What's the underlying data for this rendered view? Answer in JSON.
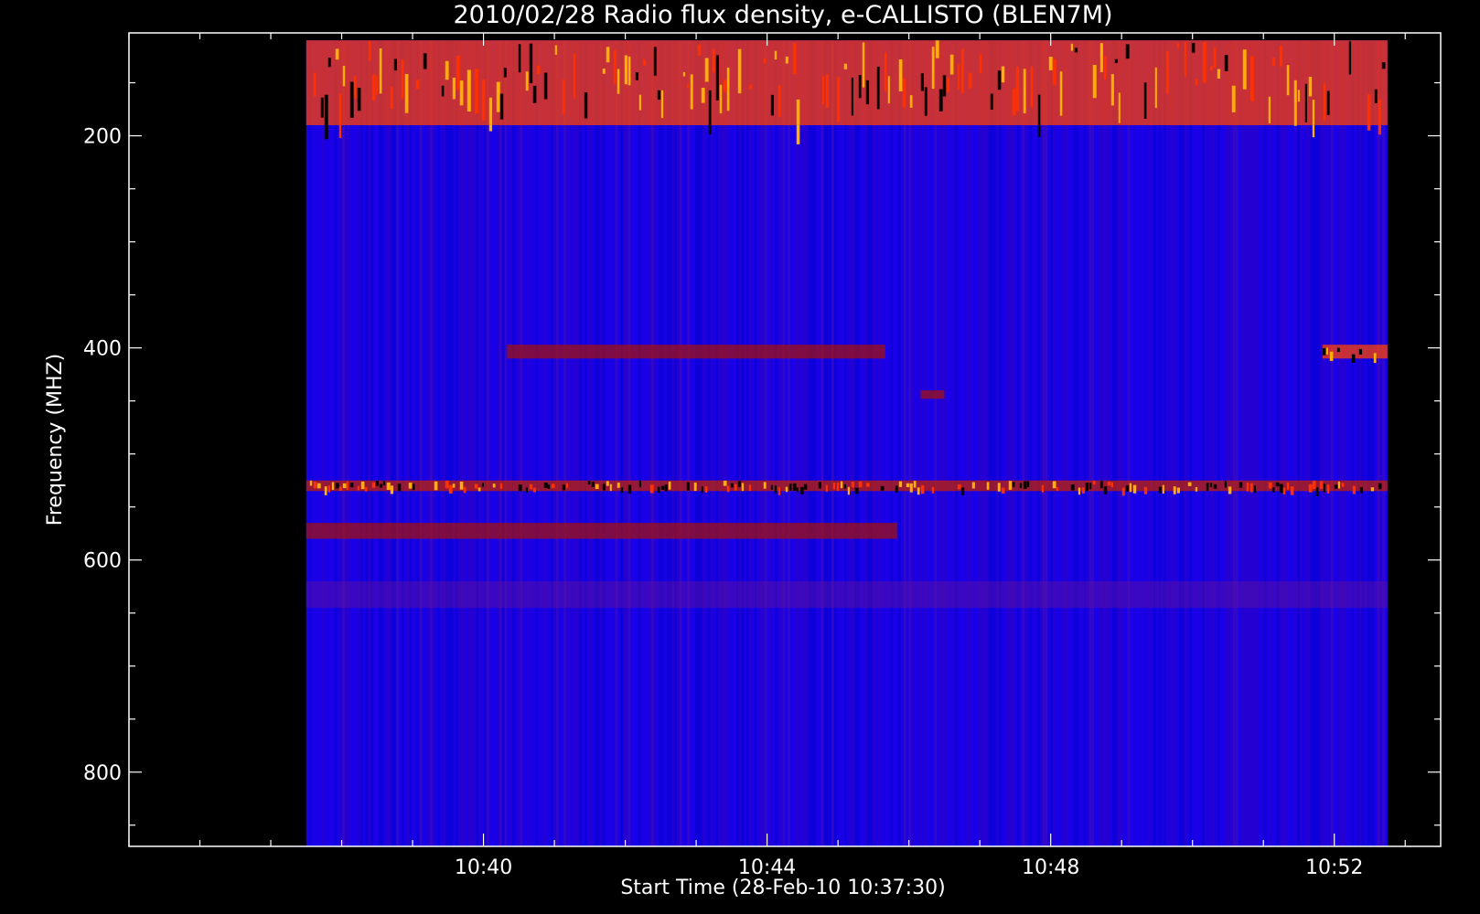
{
  "chart_data": {
    "type": "heatmap",
    "title": "2010/02/28  Radio flux density, e-CALLISTO (BLEN7M)",
    "xlabel": "Start Time (28-Feb-10 10:37:30)",
    "ylabel": "Frequency (MHZ)",
    "x_range": [
      "10:37:30",
      "10:52:45"
    ],
    "xlim": [
      "10:35",
      "10:53:30"
    ],
    "ylim": [
      870,
      103
    ],
    "y_inverted": true,
    "x_ticks": [
      "10:40",
      "10:44",
      "10:48",
      "10:52"
    ],
    "x_minor_tick_minutes": 1,
    "y_ticks": [
      200,
      400,
      600,
      800
    ],
    "y_minor_tick_step": 50,
    "data_freq_range": [
      110,
      870
    ],
    "colormap": [
      "#000000",
      "#0000ff",
      "#a00000",
      "#ff3000",
      "#ffb000"
    ],
    "background_level": "blue",
    "features": [
      {
        "freq_range": [
          110,
          190
        ],
        "time_range": [
          "10:37:30",
          "10:52:45"
        ],
        "intensity": "high",
        "note": "strong interference bands"
      },
      {
        "freq_range": [
          397,
          410
        ],
        "time_range": [
          "10:40:20",
          "10:45:40"
        ],
        "intensity": "medium"
      },
      {
        "freq_range": [
          397,
          410
        ],
        "time_range": [
          "10:51:50",
          "10:52:45"
        ],
        "intensity": "high"
      },
      {
        "freq_range": [
          525,
          535
        ],
        "time_range": [
          "10:37:30",
          "10:52:45"
        ],
        "intensity": "medium-high"
      },
      {
        "freq_range": [
          565,
          580
        ],
        "time_range": [
          "10:37:30",
          "10:45:50"
        ],
        "intensity": "medium"
      },
      {
        "freq_range": [
          620,
          645
        ],
        "time_range": [
          "10:37:30",
          "10:52:45"
        ],
        "intensity": "low"
      },
      {
        "freq_range": [
          440,
          448
        ],
        "time_range": [
          "10:46:10",
          "10:46:30"
        ],
        "intensity": "medium"
      }
    ]
  }
}
